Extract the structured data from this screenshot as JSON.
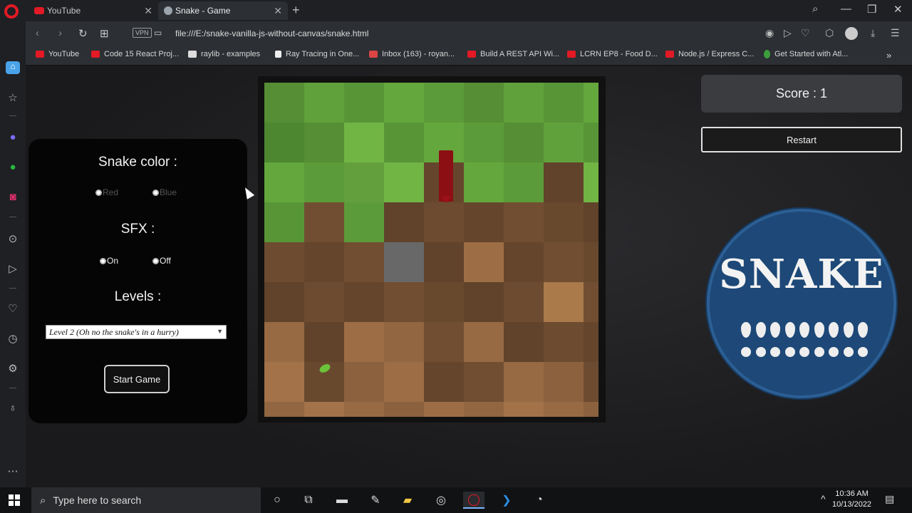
{
  "browser": {
    "tabs": [
      {
        "title": "YouTube",
        "close": "✕"
      },
      {
        "title": "Snake - Game",
        "close": "✕"
      }
    ],
    "new_tab": "+",
    "address": "file:///E:/snake-vanilla-js-without-canvas/snake.html",
    "vpn_label": "VPN",
    "bookmarks": [
      "YouTube",
      "Code 15 React Proj...",
      "raylib - examples",
      "Ray Tracing in One...",
      "Inbox (163) - royan...",
      "Build A REST API Wi...",
      "LCRN EP8 - Food D...",
      "Node.js / Express C...",
      "Get Started with Atl..."
    ],
    "bookmarks_more": "»"
  },
  "game": {
    "snake_color_title": "Snake color :",
    "color_options": [
      "Red",
      "Blue"
    ],
    "sfx_title": "SFX :",
    "sfx_options": [
      "On",
      "Off"
    ],
    "levels_title": "Levels :",
    "level_selected": "Level 2 (Oh no the snake's in a hurry)",
    "start_label": "Start Game",
    "score_text": "Score : 1",
    "restart_label": "Restart",
    "logo_text": "SNAKE"
  },
  "taskbar": {
    "search_placeholder": "Type here to search",
    "time": "10:36 AM",
    "date": "10/13/2022"
  },
  "colors": {
    "opera_red": "#e11a25",
    "grass": "#5e9e3a",
    "dirt": "#8a6040",
    "snake": "#8c0f14",
    "logo_blue": "#1d4877"
  }
}
